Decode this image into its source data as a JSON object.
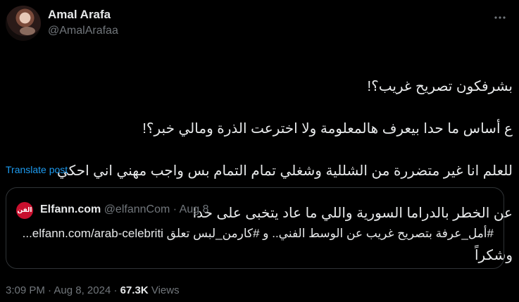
{
  "author": {
    "display_name": "Amal Arafa",
    "handle": "@AmalArafaa"
  },
  "tweet": {
    "lines": [
      "بشرفكون تصريح غريب؟!",
      "ع أساس ما حدا بيعرف هالمعلومة ولا اخترعت الذرة ومالي خبر؟!",
      "للعلم انا غير متضررة من الشللية وشغلي تمام التمام بس واجب مهني اني احكي",
      "عن الخطر بالدراما السورية واللي ما عاد يتخبى على حدا",
      "وشكراً"
    ],
    "translate_label": "Translate post"
  },
  "quote": {
    "avatar_text": "الفن",
    "name": "Elfann.com",
    "handle": "@elfannCom",
    "separator": "·",
    "date": "Aug 8",
    "text": "#أمل_عرفة بتصريح غريب عن الوسط الفني.. و #كارمن_لبس تعلق elfann.com/arab-celebriti..."
  },
  "footer": {
    "time": "3:09 PM",
    "separator": "·",
    "date": "Aug 8, 2024",
    "views_count": "67.3K",
    "views_label": "Views"
  },
  "icons": {
    "more": "more-horizontal-icon"
  }
}
